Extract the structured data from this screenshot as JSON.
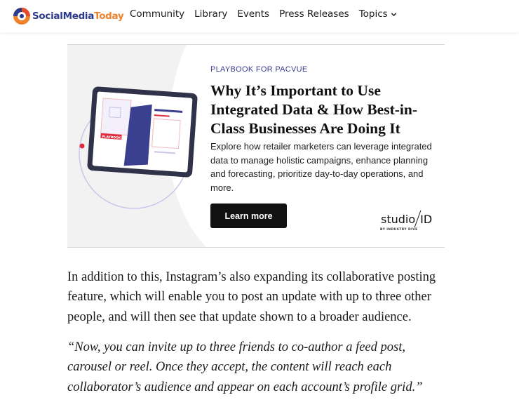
{
  "header": {
    "logo": {
      "part1": "Social",
      "part2": "Media",
      "part3": "Today"
    },
    "nav": [
      {
        "label": "Community"
      },
      {
        "label": "Library"
      },
      {
        "label": "Events"
      },
      {
        "label": "Press Releases"
      },
      {
        "label": "Topics"
      }
    ]
  },
  "ad": {
    "kicker": "PLAYBOOK FOR PACVUE",
    "title": "Why It’s Important to Use Integrated Data & How Best-in-Class Businesses Are Doing It",
    "description": "Explore how retailer marketers can leverage integrated data to manage holistic campaigns, enhance planning and forecasting, prioritize day-to-day operations, and more.",
    "cta_label": "Learn more",
    "brand_left": "studio",
    "brand_right": "ID",
    "brand_sub": "BY INDUSTRY DIVE",
    "tablet_badge": "PLAYBOOK",
    "colors": {
      "kicker": "#3a3d8f",
      "tablet_accent": "#3b3f8f",
      "badge": "#e02a3a"
    }
  },
  "article": {
    "paragraph": "In addition to this, Instagram’s also expanding its collaborative posting feature, which will enable you to post an update with up to three other people, and will then see that update shown to a broader audience.",
    "quote": "“Now, you can invite up to three friends to co-author a feed post, carousel or reel. Once they accept, the content will reach each collaborator’s audience and appear on each account’s profile grid.”"
  }
}
